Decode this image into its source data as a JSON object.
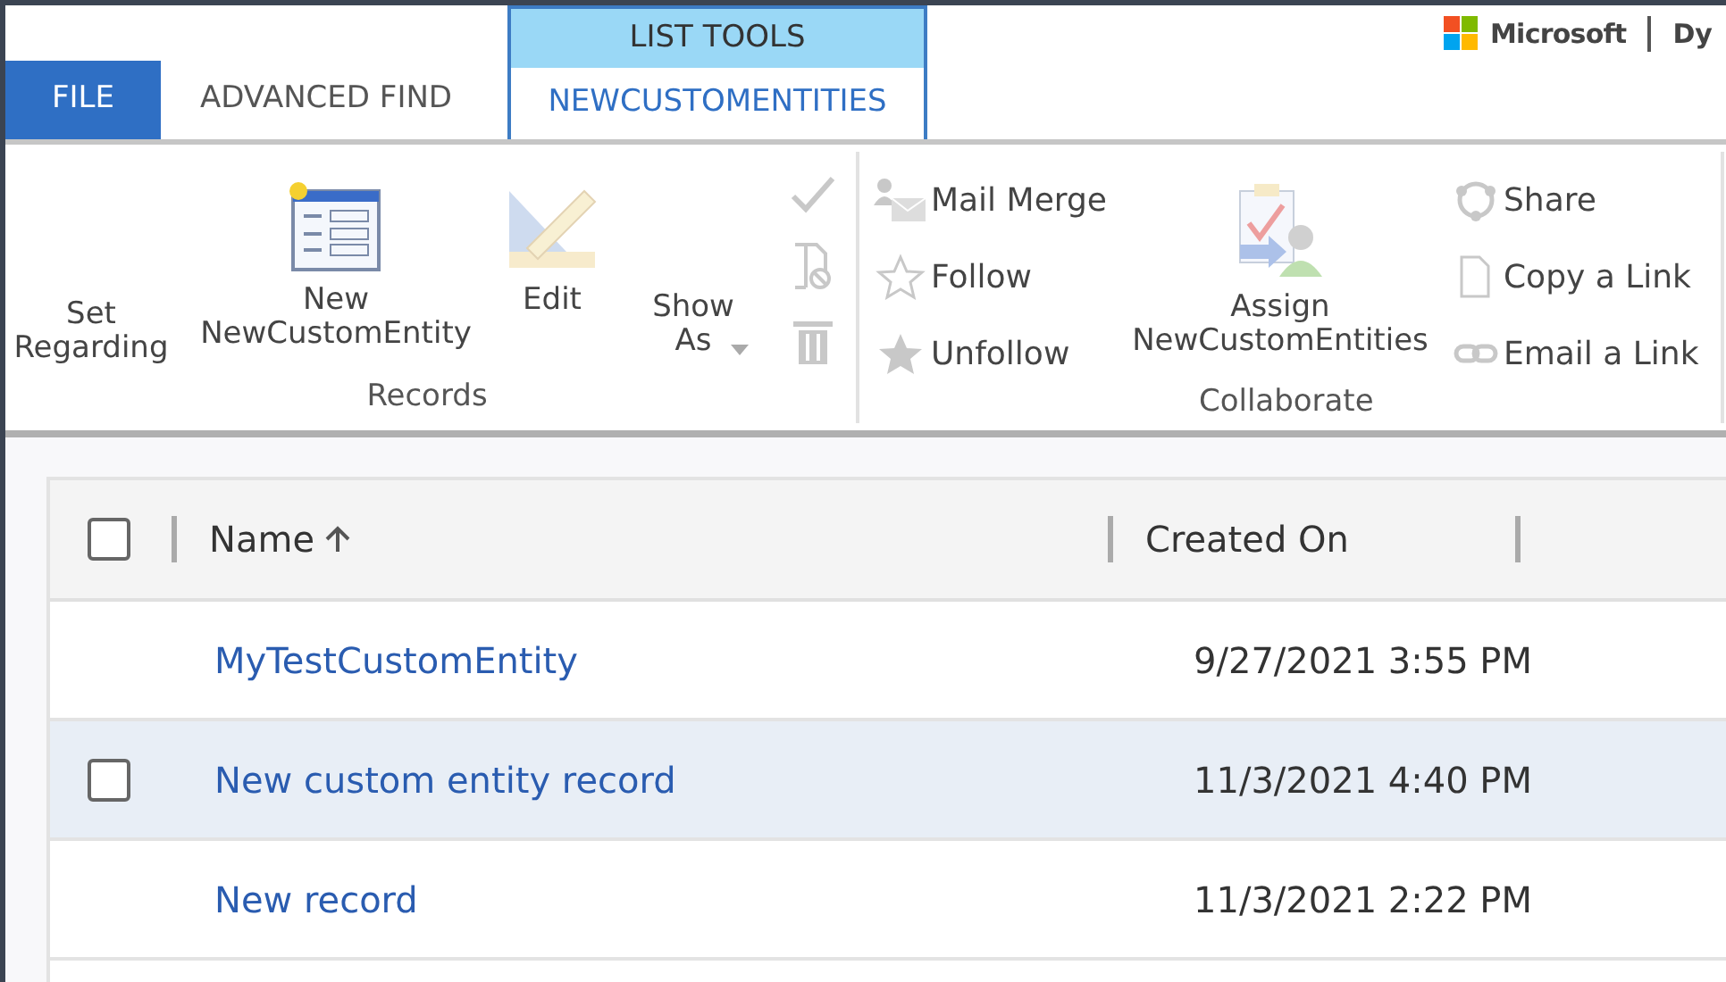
{
  "tabs": [
    {
      "label": "FILE",
      "kind": "file",
      "selected": false
    },
    {
      "label": "ADVANCED FIND",
      "kind": "plain",
      "selected": false
    }
  ],
  "context_tab": {
    "group": "LIST TOOLS",
    "label": "NEWCUSTOMENTITIES",
    "selected": true
  },
  "brand": {
    "name": "Microsoft",
    "product": "Dy"
  },
  "ribbon": {
    "groups": [
      {
        "label": "Records",
        "items": [
          {
            "kind": "text",
            "label": "Set Regarding"
          },
          {
            "kind": "large",
            "label": "New NewCustomEntity"
          },
          {
            "kind": "large",
            "label": "Edit"
          },
          {
            "kind": "menu",
            "label": "Show As"
          },
          {
            "kind": "icons"
          }
        ]
      },
      {
        "label": "Collaborate",
        "items": [
          {
            "kind": "small",
            "entries": [
              {
                "label": "Mail Merge"
              },
              {
                "label": "Follow"
              },
              {
                "label": "Unfollow"
              }
            ]
          },
          {
            "kind": "large",
            "label": "Assign NewCustomEntities"
          },
          {
            "kind": "small",
            "entries": [
              {
                "label": "Share"
              },
              {
                "label": "Copy a Link"
              },
              {
                "label": "Email a Link"
              }
            ]
          }
        ]
      }
    ]
  },
  "grid": {
    "select_all": {
      "checked": false
    },
    "columns": [
      {
        "label": "Name",
        "sorted": true
      },
      {
        "label": "Created On",
        "sorted": false
      }
    ],
    "rows": [
      {
        "name": "MyTestCustomEntity",
        "created_on": "9/27/2021 3:55 PM",
        "highlighted": false
      },
      {
        "name": "New custom entity record",
        "created_on": "11/3/2021 4:40 PM",
        "highlighted": true
      },
      {
        "name": "New record",
        "created_on": "11/3/2021 2:22 PM",
        "highlighted": false
      }
    ]
  }
}
